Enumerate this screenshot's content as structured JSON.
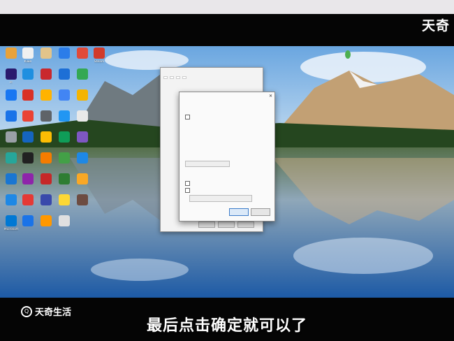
{
  "watermark_top": "天奇",
  "brand_name": "天奇生活",
  "subtitle": "最后点击确定就可以了",
  "desktop_icons": [
    {
      "label": "",
      "color": "#e8a23a"
    },
    {
      "label": "Kiwe",
      "color": "#f0f0f0"
    },
    {
      "label": "",
      "color": "#e2c48a"
    },
    {
      "label": "",
      "color": "#2b7de9"
    },
    {
      "label": "",
      "color": "#e04b3a"
    },
    {
      "label": "Steam",
      "color": "#d13b2b"
    },
    {
      "label": "Pr",
      "color": "#2a1a6e"
    },
    {
      "label": "",
      "color": "#1e8fe0"
    },
    {
      "label": "",
      "color": "#c9282d"
    },
    {
      "label": "",
      "color": "#1d6fd6"
    },
    {
      "label": "",
      "color": "#34a853"
    },
    {
      "label": "",
      "color": "#1877f2"
    },
    {
      "label": "",
      "color": "#d93025"
    },
    {
      "label": "",
      "color": "#ffb300"
    },
    {
      "label": "",
      "color": "#4285f4"
    },
    {
      "label": "",
      "color": "#f4b400"
    },
    {
      "label": "",
      "color": "#1a73e8"
    },
    {
      "label": "",
      "color": "#ea4335"
    },
    {
      "label": "",
      "color": "#5f6368"
    },
    {
      "label": "",
      "color": "#2196f3"
    },
    {
      "label": "",
      "color": "#e9e9e9"
    },
    {
      "label": "",
      "color": "#9aa0a6"
    },
    {
      "label": "",
      "color": "#1565c0"
    },
    {
      "label": "",
      "color": "#fbbc04"
    },
    {
      "label": "",
      "color": "#0f9d58"
    },
    {
      "label": "",
      "color": "#7e57c2"
    },
    {
      "label": "",
      "color": "#26a69a"
    },
    {
      "label": "",
      "color": "#212121"
    },
    {
      "label": "",
      "color": "#f57c00"
    },
    {
      "label": "",
      "color": "#43a047"
    },
    {
      "label": "",
      "color": "#1e88e5"
    },
    {
      "label": "",
      "color": "#1976d2"
    },
    {
      "label": "",
      "color": "#8e24aa"
    },
    {
      "label": "",
      "color": "#c62828"
    },
    {
      "label": "",
      "color": "#2e7d32"
    },
    {
      "label": "",
      "color": "#f9a825"
    },
    {
      "label": "",
      "color": "#1e88e5"
    },
    {
      "label": "",
      "color": "#e53935"
    },
    {
      "label": "",
      "color": "#3949ab"
    },
    {
      "label": "",
      "color": "#fdd835"
    },
    {
      "label": "",
      "color": "#6d4c41"
    },
    {
      "label": "Microsoft",
      "color": "#0078d4"
    },
    {
      "label": "",
      "color": "#1a73e8"
    },
    {
      "label": "",
      "color": "#ff9800"
    },
    {
      "label": "",
      "color": "#e0e0e0"
    }
  ],
  "dialog_back": {
    "title": "",
    "tabs": [
      "",
      "",
      "",
      ""
    ],
    "buttons": [
      "",
      "",
      ""
    ]
  },
  "dialog_front": {
    "title": "",
    "close": "✕",
    "ok": "",
    "cancel": "",
    "field": "",
    "select": ""
  }
}
